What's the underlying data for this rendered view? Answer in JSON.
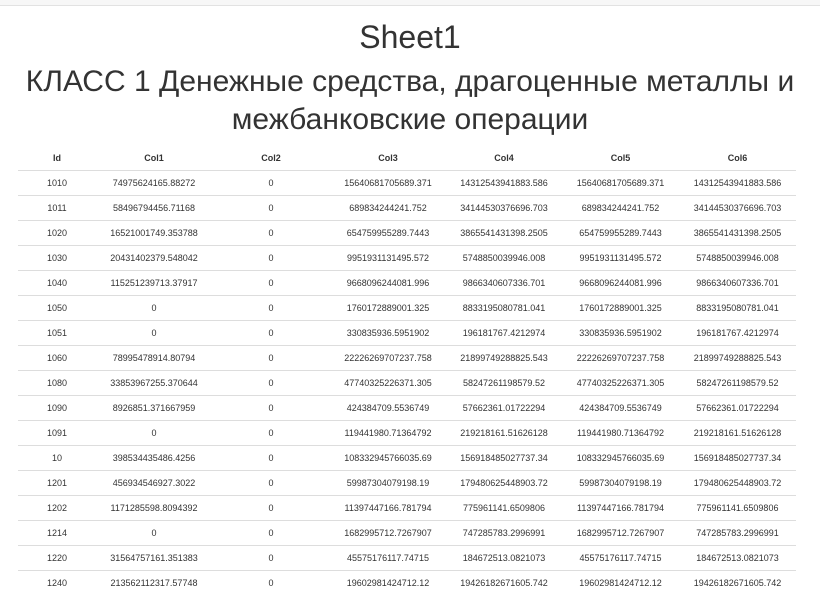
{
  "page": {
    "sheet_title": "Sheet1",
    "class_title": "КЛАСС 1 Денежные средства, драгоценные металлы и межбанковские операции"
  },
  "table": {
    "headers": [
      "Id",
      "Col1",
      "Col2",
      "Col3",
      "Col4",
      "Col5",
      "Col6"
    ],
    "rows": [
      [
        "1010",
        "74975624165.88272",
        "0",
        "15640681705689.371",
        "14312543941883.586",
        "15640681705689.371",
        "14312543941883.586"
      ],
      [
        "1011",
        "58496794456.71168",
        "0",
        "689834244241.752",
        "34144530376696.703",
        "689834244241.752",
        "34144530376696.703"
      ],
      [
        "1020",
        "16521001749.353788",
        "0",
        "654759955289.7443",
        "3865541431398.2505",
        "654759955289.7443",
        "3865541431398.2505"
      ],
      [
        "1030",
        "20431402379.548042",
        "0",
        "9951931131495.572",
        "5748850039946.008",
        "9951931131495.572",
        "5748850039946.008"
      ],
      [
        "1040",
        "115251239713.37917",
        "0",
        "9668096244081.996",
        "9866340607336.701",
        "9668096244081.996",
        "9866340607336.701"
      ],
      [
        "1050",
        "0",
        "0",
        "1760172889001.325",
        "8833195080781.041",
        "1760172889001.325",
        "8833195080781.041"
      ],
      [
        "1051",
        "0",
        "0",
        "330835936.5951902",
        "196181767.4212974",
        "330835936.5951902",
        "196181767.4212974"
      ],
      [
        "1060",
        "78995478914.80794",
        "0",
        "22226269707237.758",
        "21899749288825.543",
        "22226269707237.758",
        "21899749288825.543"
      ],
      [
        "1080",
        "33853967255.370644",
        "0",
        "47740325226371.305",
        "58247261198579.52",
        "47740325226371.305",
        "58247261198579.52"
      ],
      [
        "1090",
        "8926851.371667959",
        "0",
        "424384709.5536749",
        "57662361.01722294",
        "424384709.5536749",
        "57662361.01722294"
      ],
      [
        "1091",
        "0",
        "0",
        "119441980.71364792",
        "219218161.51626128",
        "119441980.71364792",
        "219218161.51626128"
      ],
      [
        "10",
        "398534435486.4256",
        "0",
        "108332945766035.69",
        "156918485027737.34",
        "108332945766035.69",
        "156918485027737.34"
      ],
      [
        "1201",
        "456934546927.3022",
        "0",
        "59987304079198.19",
        "179480625448903.72",
        "59987304079198.19",
        "179480625448903.72"
      ],
      [
        "1202",
        "1171285598.8094392",
        "0",
        "11397447166.781794",
        "775961141.6509806",
        "11397447166.781794",
        "775961141.6509806"
      ],
      [
        "1214",
        "0",
        "0",
        "1682995712.7267907",
        "747285783.2996991",
        "1682995712.7267907",
        "747285783.2996991"
      ],
      [
        "1220",
        "31564757161.351383",
        "0",
        "45575176117.74715",
        "184672513.0821073",
        "45575176117.74715",
        "184672513.0821073"
      ],
      [
        "1240",
        "213562112317.57748",
        "0",
        "19602981424712.12",
        "19426182671605.742",
        "19602981424712.12",
        "19426182671605.742"
      ]
    ]
  }
}
